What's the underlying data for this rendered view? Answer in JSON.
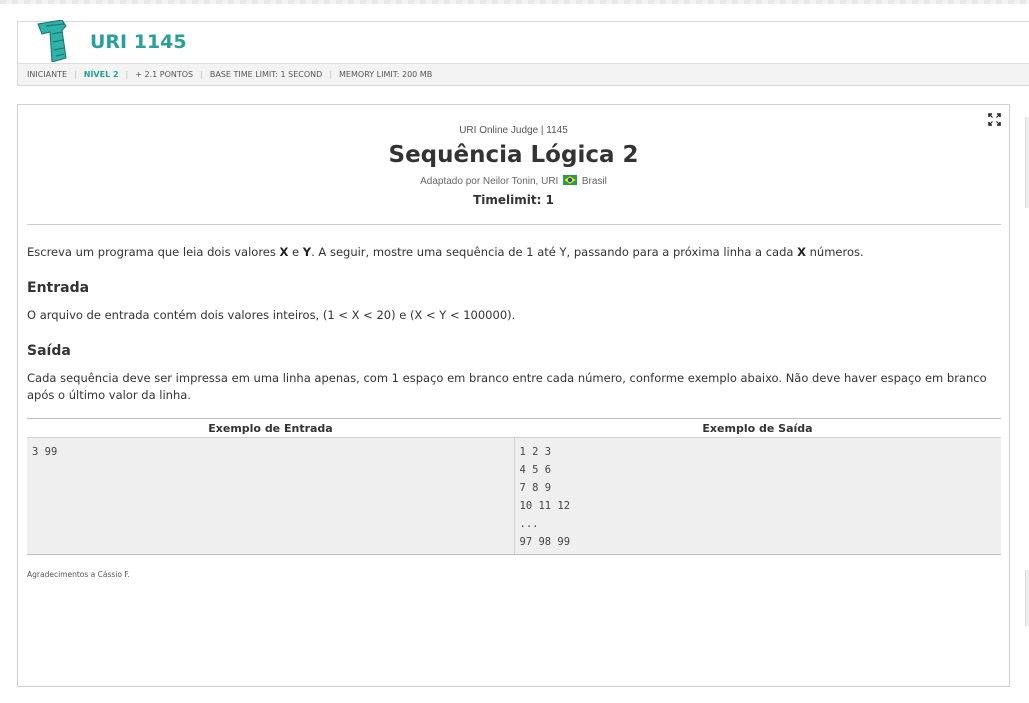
{
  "header": {
    "problem_code": "URI 1145",
    "meta": {
      "category": "INICIANTE",
      "level": "NÍVEL 2",
      "points": "+ 2.1 PONTOS",
      "base_time": "BASE TIME LIMIT: 1 SECOND",
      "memory": "MEMORY LIMIT: 200 MB"
    }
  },
  "problem": {
    "judge_line": "URI Online Judge | 1145",
    "title": "Sequência Lógica 2",
    "adapted_prefix": "Adaptado por Neilor Tonin, URI",
    "country": "Brasil",
    "timelimit": "Timelimit: 1",
    "description": {
      "p1": "Escreva um programa que leia dois valores ",
      "x": "X",
      "p2": " e ",
      "y": "Y",
      "p3": ". A seguir, mostre uma sequência de 1 até Y, passando para a próxima linha a cada ",
      "x2": "X",
      "p4": " números."
    },
    "input_heading": "Entrada",
    "input_text": "O arquivo de entrada contém dois valores inteiros, (1 < X < 20) e (X < Y < 100000).",
    "output_heading": "Saída",
    "output_text": "Cada sequência deve ser impressa em uma linha apenas, com 1 espaço em branco entre cada número, conforme exemplo abaixo. Não deve haver espaço em branco após o último valor da linha.",
    "example": {
      "input_header": "Exemplo de Entrada",
      "output_header": "Exemplo de Saída",
      "input_lines": [
        "3 99"
      ],
      "output_lines": [
        "1 2 3",
        "4 5 6",
        "7 8 9",
        "10 11 12",
        "...",
        "97 98 99"
      ]
    },
    "thanks": "Agradecimentos a Cássio F."
  },
  "colors": {
    "accent": "#28a099"
  },
  "icons": {
    "logo": "level-logo-icon",
    "expand": "expand-icon",
    "flag": "brazil-flag-icon"
  }
}
